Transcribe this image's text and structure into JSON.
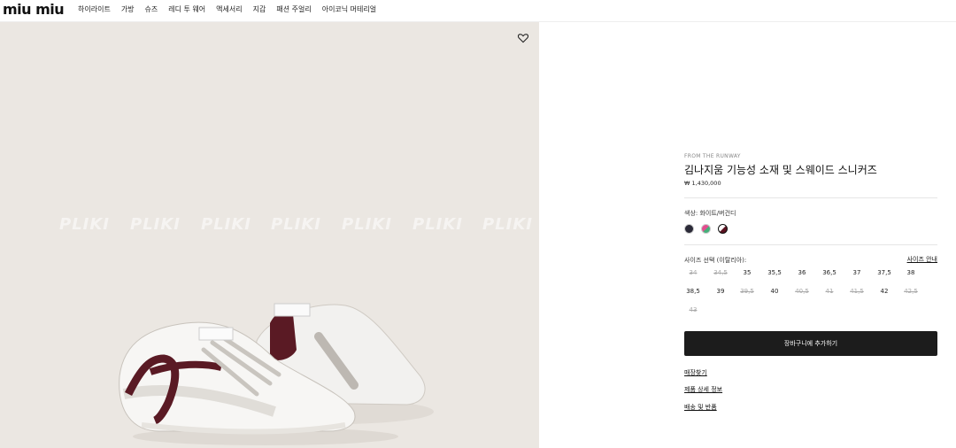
{
  "header": {
    "logo": "miu miu",
    "nav": [
      "하이라이트",
      "가방",
      "슈즈",
      "레디 투 웨어",
      "액세서리",
      "지갑",
      "패션 주얼리",
      "아이코닉 머테리얼"
    ]
  },
  "image": {
    "watermark": "PLIKI",
    "wishlist_icon": "heart-icon"
  },
  "product": {
    "eyebrow": "FROM THE RUNWAY",
    "title": "김나지움 기능성 소재 및 스웨이드 스니커즈",
    "price": "₩ 1,430,000",
    "color_label": "색상: 화이트/버건디",
    "swatch_colors": [
      "#2b2a38",
      "#e24d8f",
      "#5b1220"
    ],
    "size_label": "사이즈 선택 (이탈리아):",
    "size_guide": "사이즈 안내",
    "sizes": [
      {
        "label": "34",
        "available": false
      },
      {
        "label": "34,5",
        "available": false
      },
      {
        "label": "35",
        "available": true
      },
      {
        "label": "35,5",
        "available": true
      },
      {
        "label": "36",
        "available": true
      },
      {
        "label": "36,5",
        "available": true
      },
      {
        "label": "37",
        "available": true
      },
      {
        "label": "37,5",
        "available": true
      },
      {
        "label": "38",
        "available": true
      },
      {
        "label": "38,5",
        "available": true
      },
      {
        "label": "39",
        "available": true
      },
      {
        "label": "39,5",
        "available": false
      },
      {
        "label": "40",
        "available": true
      },
      {
        "label": "40,5",
        "available": false
      },
      {
        "label": "41",
        "available": false
      },
      {
        "label": "41,5",
        "available": false
      },
      {
        "label": "42",
        "available": true
      },
      {
        "label": "42,5",
        "available": false
      },
      {
        "label": "43",
        "available": false
      }
    ],
    "add_to_cart": "장바구니에 추가하기",
    "links": [
      "매장찾기",
      "제품 상세 정보",
      "배송 및 반품"
    ]
  }
}
